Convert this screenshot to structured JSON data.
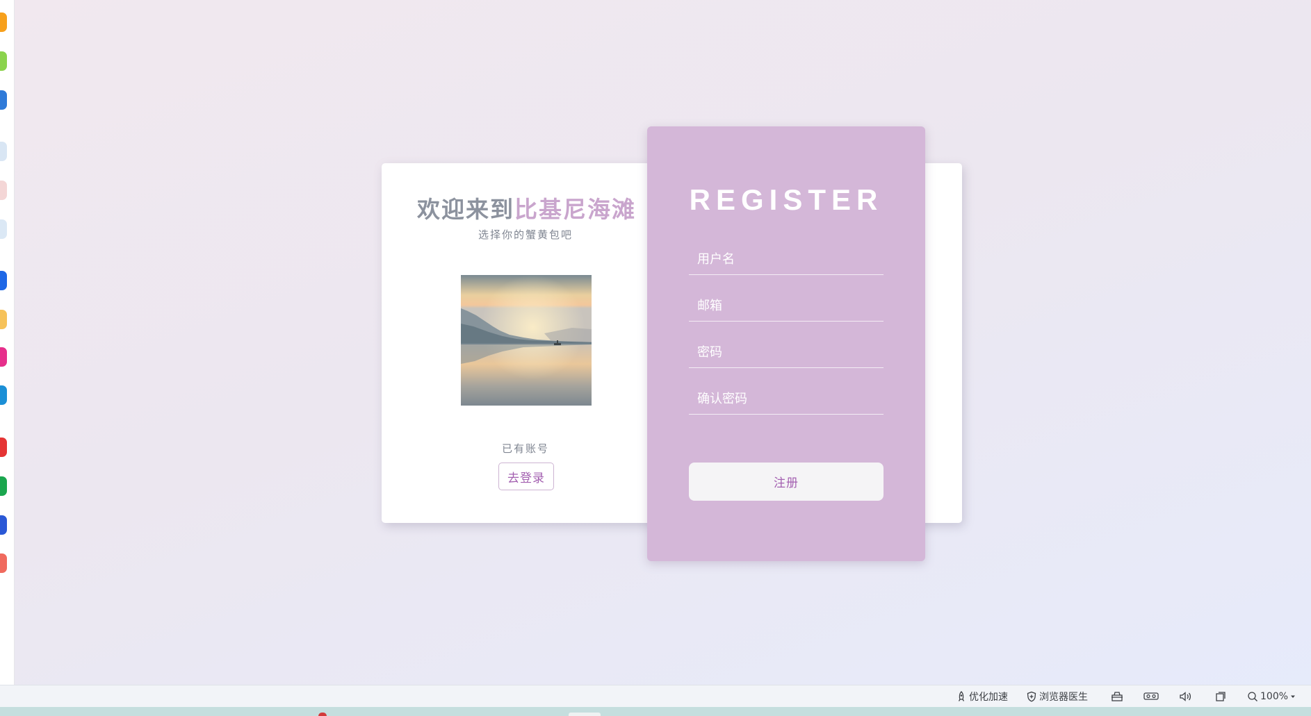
{
  "login_panel": {
    "welcome_prefix": "欢迎来到",
    "welcome_highlight": "比基尼海滩",
    "subtitle": "选择你的蟹黄包吧",
    "have_account_text": "已有账号",
    "go_login_label": "去登录"
  },
  "register_panel": {
    "title": "REGISTER",
    "fields": {
      "username_placeholder": "用户名",
      "email_placeholder": "邮箱",
      "password_placeholder": "密码",
      "confirm_password_placeholder": "确认密码"
    },
    "submit_label": "注册"
  },
  "status_bar": {
    "optimize_label": "优化加速",
    "browser_doctor_label": "浏览器医生",
    "zoom_level": "100%"
  },
  "colors": {
    "register_panel_bg": "#d4b7d8",
    "accent_text": "#a35fb0",
    "title_gray": "#8c929e",
    "title_highlight": "#c9a5cd"
  },
  "icons": {
    "optimize": "rocket-icon",
    "browser_doctor": "shield-plus-icon",
    "extension": "bag-icon",
    "reading_mode": "vr-glasses-icon",
    "sound": "speaker-icon",
    "window": "window-icon",
    "zoom": "magnifier-icon",
    "zoom_menu": "triangle-down-icon"
  }
}
